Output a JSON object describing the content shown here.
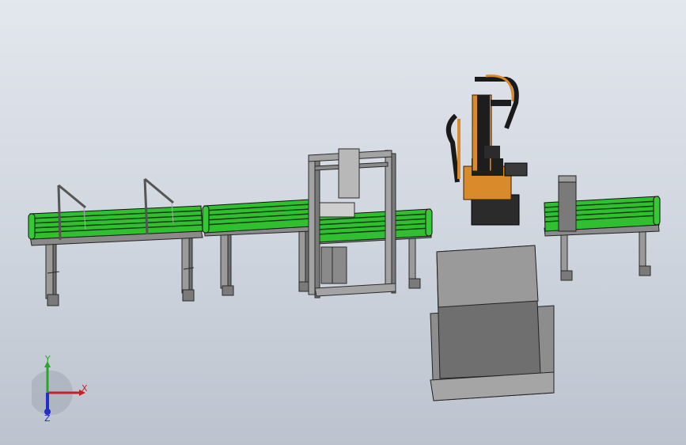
{
  "viewport": {
    "background_top": "#e3e7ee",
    "background_bottom": "#bcc3ce"
  },
  "scene": {
    "objects": [
      {
        "name": "conveyor-belt",
        "color": "#2fbf2f"
      },
      {
        "name": "conveyor-belt",
        "color": "#2fbf2f"
      },
      {
        "name": "gantry-frame",
        "color": "#8e8e8e"
      },
      {
        "name": "conveyor-belt",
        "color": "#2fbf2f"
      },
      {
        "name": "palletizing-robot",
        "color": "#d98a2b"
      },
      {
        "name": "conveyor-belt",
        "color": "#2fbf2f"
      },
      {
        "name": "pallet-station",
        "color": "#8f8f8f"
      }
    ]
  },
  "triad": {
    "x_label": "X",
    "y_label": "Y",
    "z_label": "Z",
    "x_color": "#c8202a",
    "y_color": "#2aa52a",
    "z_color": "#2030c0"
  }
}
